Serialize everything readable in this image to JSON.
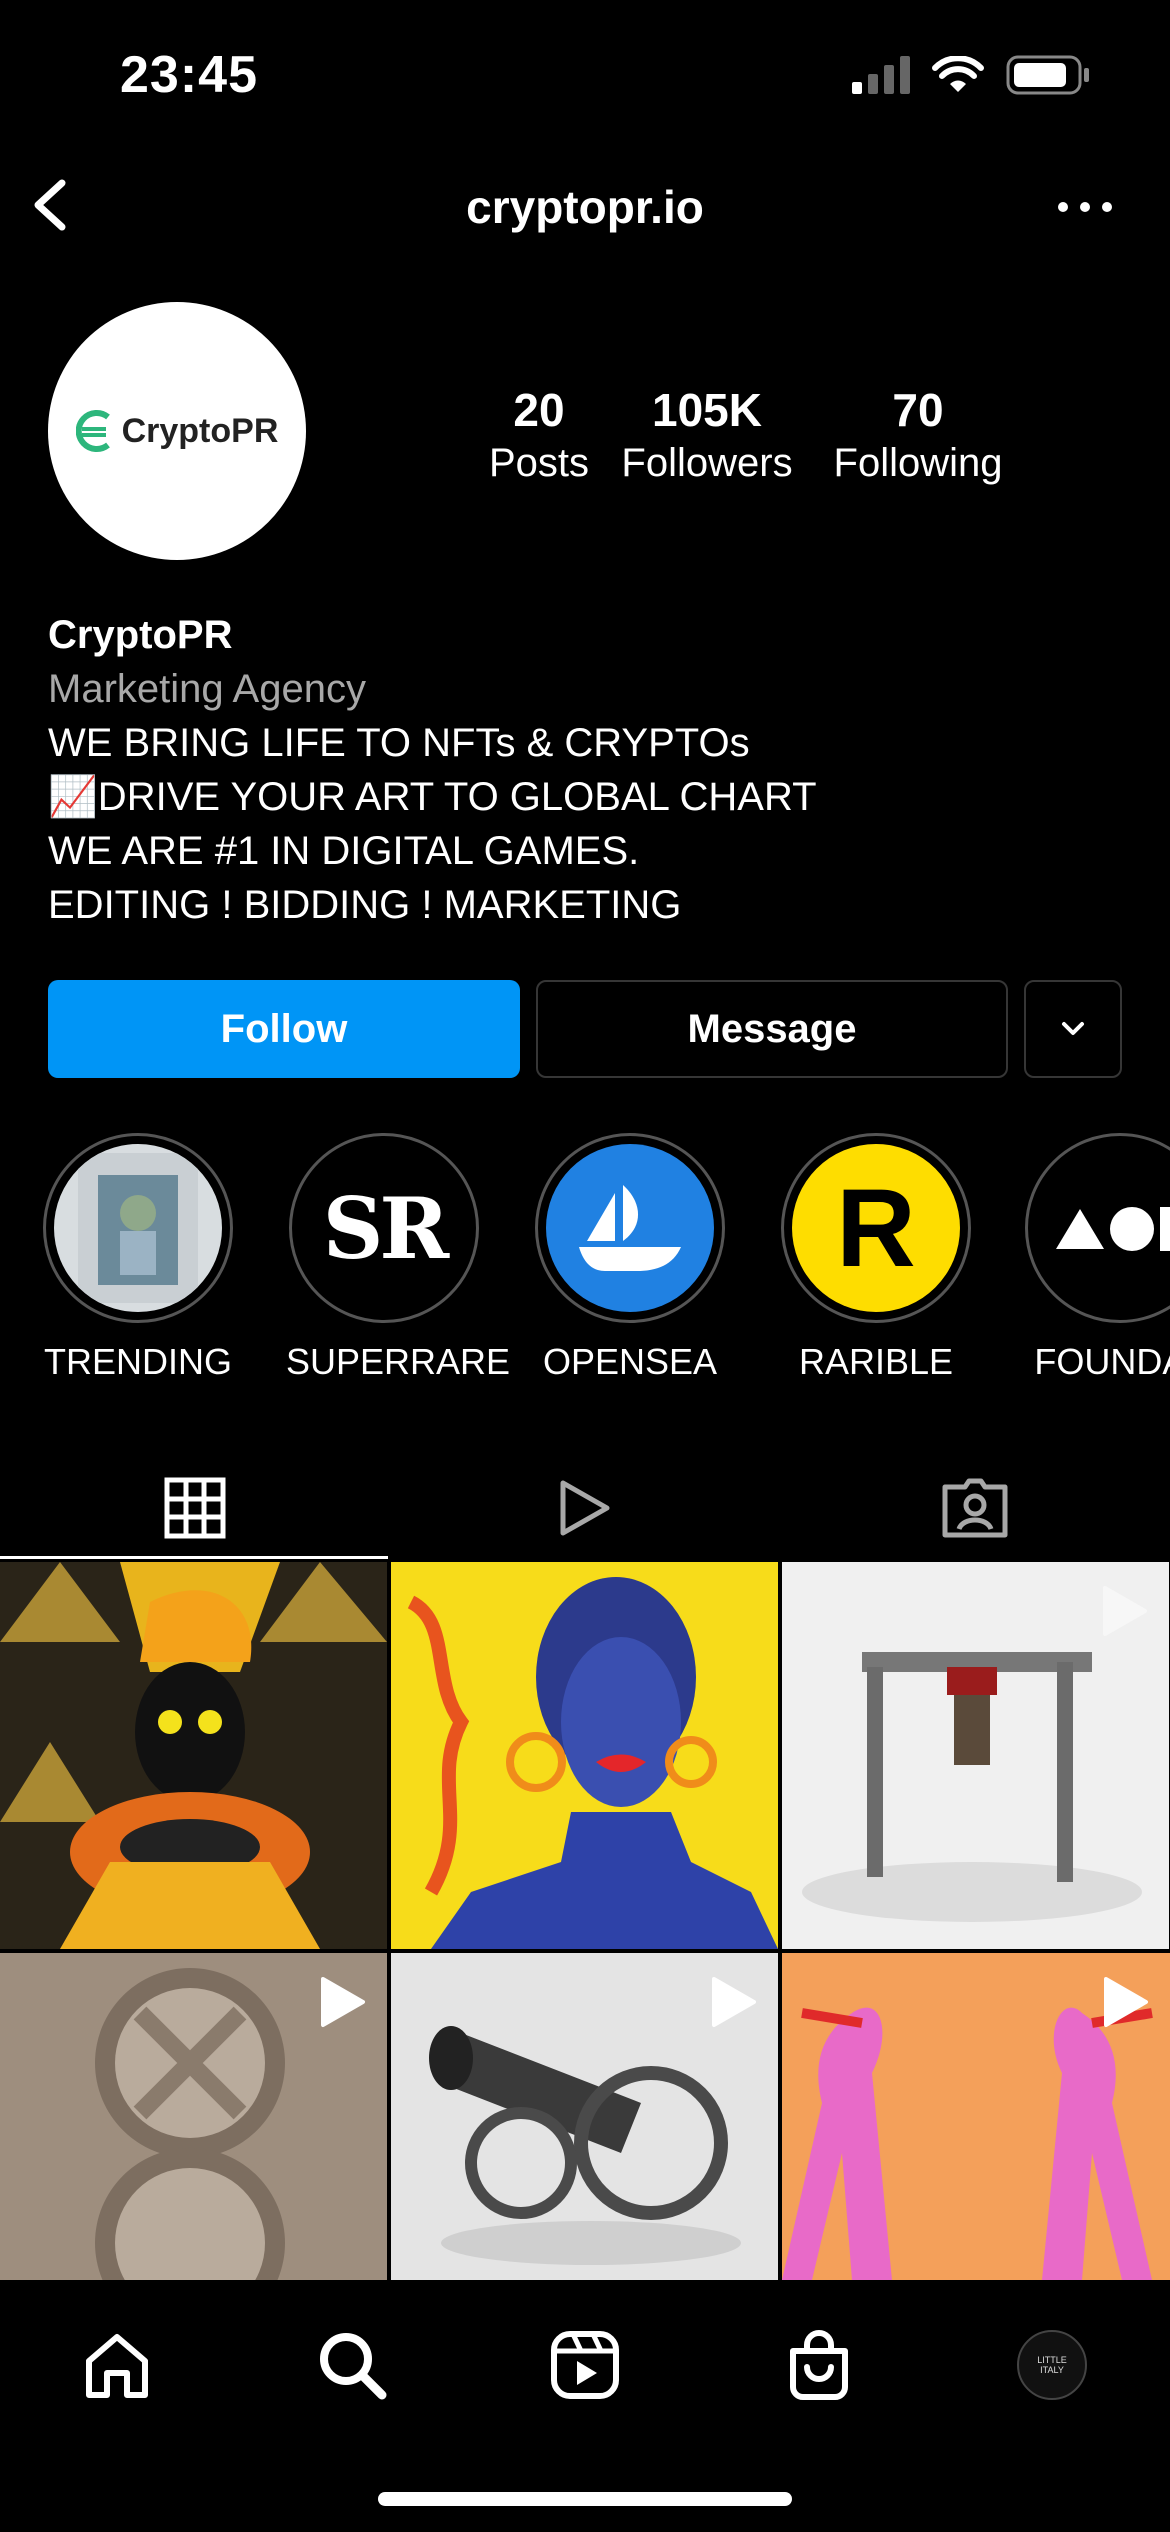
{
  "status_bar": {
    "time": "23:45"
  },
  "header": {
    "handle": "cryptopr.io"
  },
  "profile": {
    "avatar_text": "CryptoPR",
    "stats": [
      {
        "count": "20",
        "label": "Posts"
      },
      {
        "count": "105K",
        "label": "Followers"
      },
      {
        "count": "70",
        "label": "Following"
      }
    ],
    "name": "CryptoPR",
    "category": "Marketing Agency",
    "bio_lines": [
      "WE BRING LIFE TO NFTs & CRYPTOs",
      "📈DRIVE YOUR ART TO GLOBAL CHART",
      "WE ARE #1 IN DIGITAL GAMES.",
      "EDITING ! BIDDING ! MARKETING"
    ]
  },
  "actions": {
    "follow_label": "Follow",
    "message_label": "Message"
  },
  "highlights": [
    {
      "label": "TRENDING"
    },
    {
      "label": "SUPERRARE",
      "text": "SR"
    },
    {
      "label": "OPENSEA"
    },
    {
      "label": "RARIBLE",
      "text": "R"
    },
    {
      "label": "FOUNDAT"
    }
  ],
  "nav": {
    "profile_avatar_text": "LITTLE ITALY"
  },
  "colors": {
    "accent": "#0095f6",
    "background": "#000000",
    "secondary_text": "#a8a8a8",
    "border": "#363636"
  }
}
